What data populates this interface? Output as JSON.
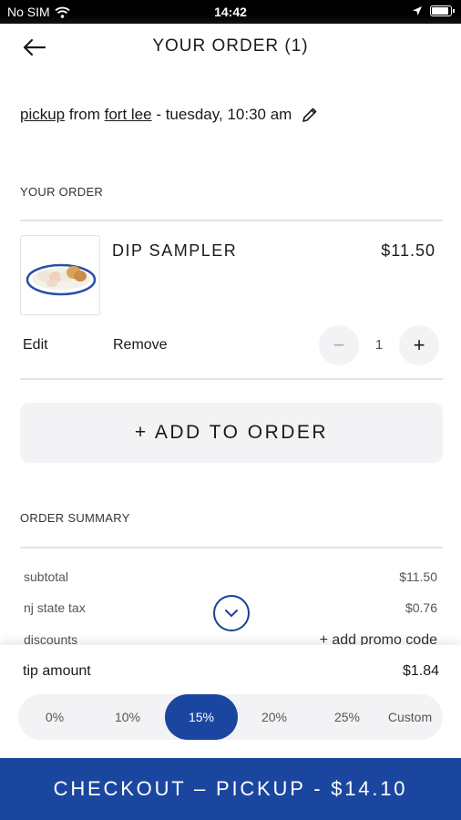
{
  "status_bar": {
    "carrier": "No SIM",
    "time": "14:42"
  },
  "header": {
    "title": "YOUR ORDER (1)"
  },
  "pickup": {
    "method": "pickup",
    "from_word": "from",
    "location": "fort lee",
    "when": "- tuesday, 10:30 am"
  },
  "order_section": {
    "label": "YOUR ORDER"
  },
  "item": {
    "name": "DIP SAMPLER",
    "price": "$11.50",
    "edit_label": "Edit",
    "remove_label": "Remove",
    "quantity": "1",
    "minus": "−",
    "plus": "+"
  },
  "add_button": {
    "label": "+ ADD TO ORDER"
  },
  "summary": {
    "label": "ORDER SUMMARY",
    "rows": [
      {
        "label": "subtotal",
        "value": "$11.50"
      },
      {
        "label": "nj state tax",
        "value": "$0.76"
      },
      {
        "label": "discounts",
        "value": "+ add promo code"
      }
    ]
  },
  "tip": {
    "label": "tip amount",
    "value": "$1.84",
    "options": [
      "0%",
      "10%",
      "15%",
      "20%",
      "25%",
      "Custom"
    ],
    "selected": "15%"
  },
  "checkout": {
    "label": "CHECKOUT – PICKUP - $14.10"
  },
  "colors": {
    "accent": "#1b46a0",
    "button_bg": "#f3f3f6",
    "divider": "#e4e4e4"
  },
  "icons": [
    "wifi-icon",
    "location-arrow-icon",
    "battery-icon",
    "back-arrow-icon",
    "pencil-icon",
    "minus-icon",
    "plus-icon",
    "chevron-down-icon"
  ]
}
